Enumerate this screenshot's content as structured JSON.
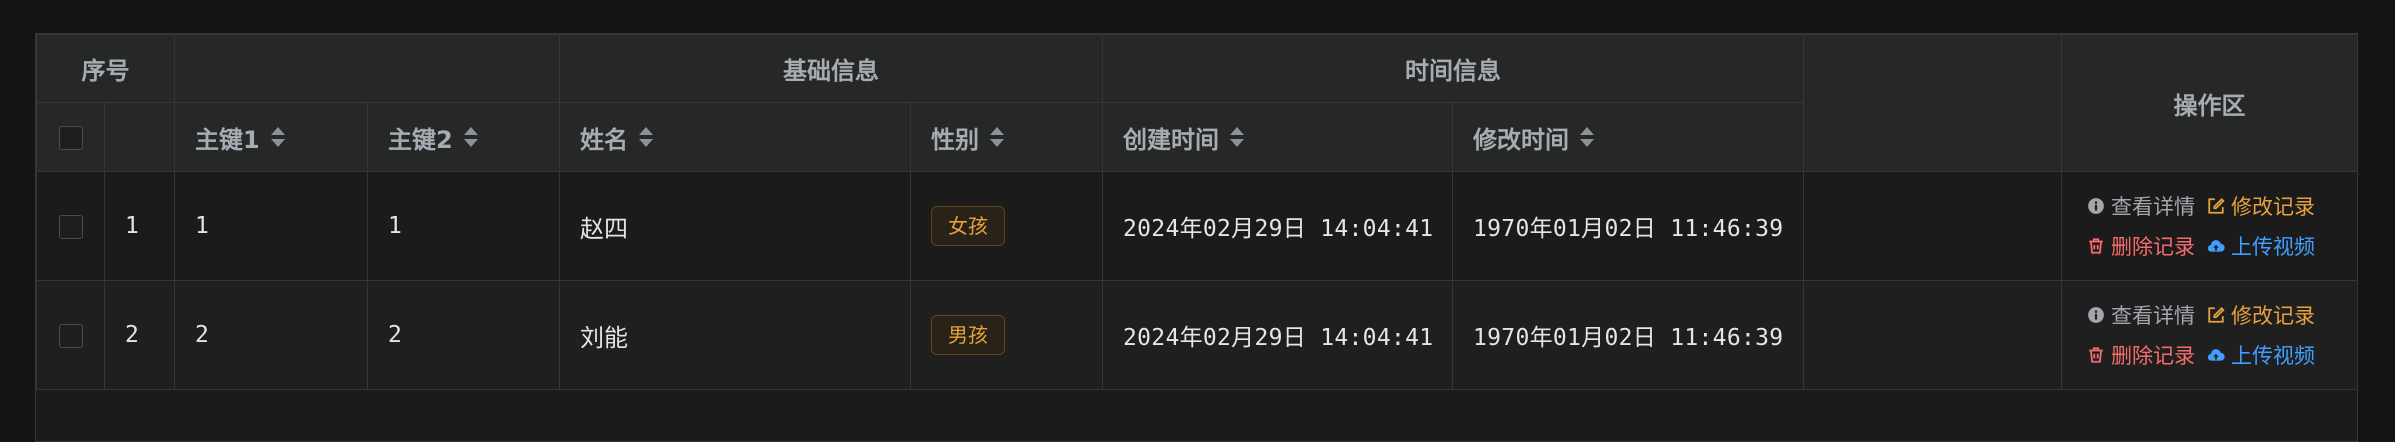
{
  "table": {
    "group_headers": {
      "seq": "序号",
      "basic": "基础信息",
      "time": "时间信息",
      "ops": "操作区"
    },
    "columns": {
      "key1": "主键1",
      "key2": "主键2",
      "name": "姓名",
      "gender": "性别",
      "created": "创建时间",
      "modified": "修改时间"
    },
    "rows": [
      {
        "index": "1",
        "key1": "1",
        "key2": "1",
        "name": "赵四",
        "gender": "女孩",
        "created": "2024年02月29日 14:04:41",
        "modified": "1970年01月02日 11:46:39"
      },
      {
        "index": "2",
        "key1": "2",
        "key2": "2",
        "name": "刘能",
        "gender": "男孩",
        "created": "2024年02月29日 14:04:41",
        "modified": "1970年01月02日 11:46:39"
      }
    ],
    "actions": {
      "detail": "查看详情",
      "edit": "修改记录",
      "delete": "删除记录",
      "upload": "上传视频"
    }
  },
  "colors": {
    "background": "#141414",
    "header_bg": "#262727",
    "border": "#363636",
    "warning": "#e6a23c",
    "danger": "#f56c6c",
    "primary": "#409eff",
    "muted": "#a3a6ad"
  },
  "icons": {
    "detail": "info-circle-icon",
    "edit": "edit-icon",
    "delete": "trash-icon",
    "upload": "cloud-upload-icon",
    "sort": "sort-caret-icon"
  }
}
